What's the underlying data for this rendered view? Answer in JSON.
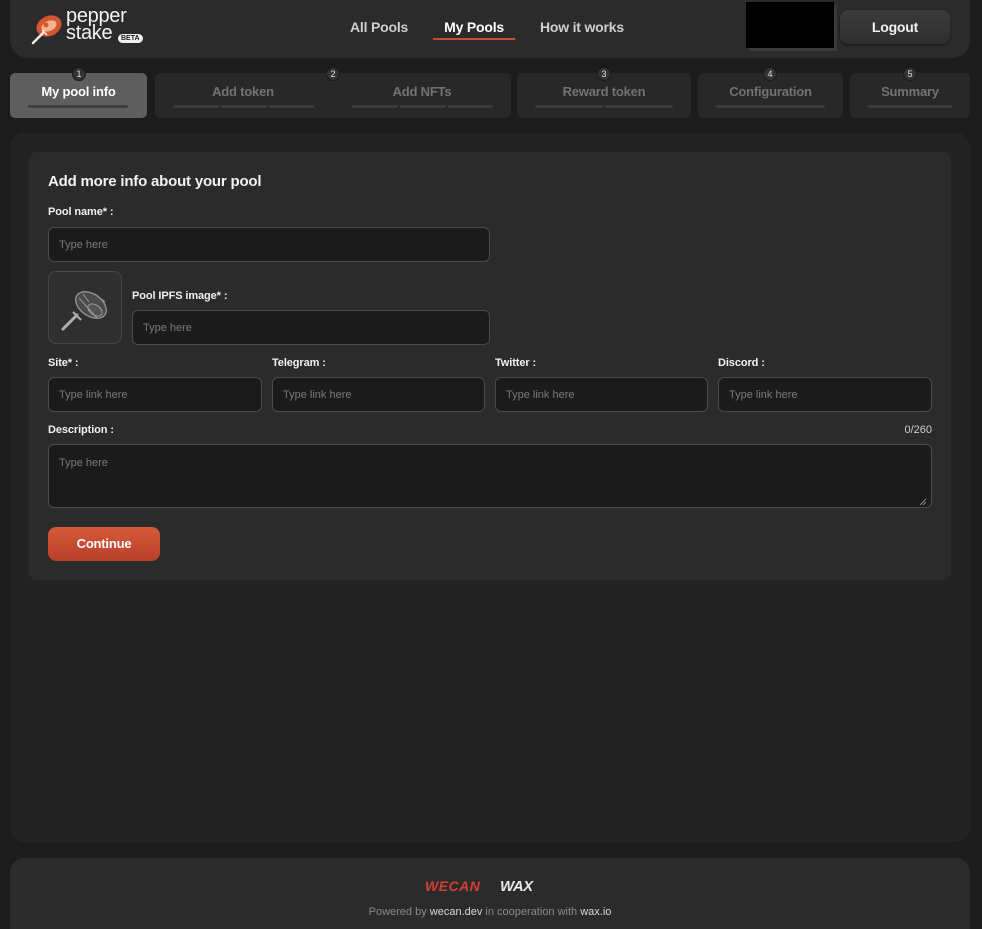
{
  "brand": {
    "name_line1": "pepper",
    "name_line2": "stake",
    "badge": "BETA",
    "accent": "#c94a35"
  },
  "nav": {
    "items": [
      {
        "label": "All Pools"
      },
      {
        "label": "My Pools"
      },
      {
        "label": "How it works"
      }
    ],
    "logout_label": "Logout"
  },
  "steps": [
    {
      "number": "1",
      "label": "My pool info"
    },
    {
      "label": "Add token"
    },
    {
      "number": "2",
      "label": "Add NFTs"
    },
    {
      "number": "3",
      "label": "Reward token"
    },
    {
      "number": "4",
      "label": "Configuration"
    },
    {
      "number": "5",
      "label": "Summary"
    }
  ],
  "form": {
    "title": "Add more info about your pool",
    "pool_name_label": "Pool name* :",
    "pool_name_placeholder": "Type here",
    "pool_image_label": "Pool IPFS image* :",
    "pool_image_placeholder": "Type here",
    "site_label": "Site* :",
    "telegram_label": "Telegram :",
    "twitter_label": "Twitter :",
    "discord_label": "Discord :",
    "link_placeholder": "Type link here",
    "description_label": "Description :",
    "description_placeholder": "Type here",
    "description_counter": "0/260",
    "continue_label": "Continue"
  },
  "footer": {
    "logo1": "WECAN",
    "logo2": "WAX",
    "powered_prefix": "Powered by ",
    "powered_link1": "wecan.dev",
    "powered_mid": " in cooperation with ",
    "powered_link2": "wax.io"
  }
}
